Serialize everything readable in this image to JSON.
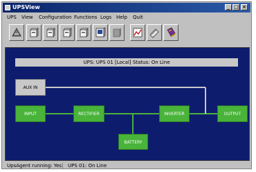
{
  "window": {
    "title": "UPSView"
  },
  "menu": [
    "UPS",
    "View",
    "Configuration",
    "Functions",
    "Logs",
    "Help",
    "Quit"
  ],
  "toolbar": [
    "ups-icon",
    "ups-unit-icon",
    "ups-unit-icon",
    "ups-unit-icon",
    "ups-unit-icon",
    "monitor-icon",
    "ups-disabled-icon",
    "chart-icon",
    "tool-icon",
    "book-icon"
  ],
  "info": "UPS: UPS 01 [Local]     Status: On Line",
  "blocks": {
    "aux": "AUX IN",
    "input": "INPUT",
    "rectifier": "RECTIFIER",
    "inverter": "INVERTER",
    "output": "OUTPUT",
    "battery": "BATTERY"
  },
  "status": {
    "left": "UpsAgent running: Yes",
    "right": "UPS 01: On Line"
  },
  "colors": {
    "diagram_bg": "#0e1c6e",
    "block_green": "#49b33a",
    "wire": "#c8c8c8"
  }
}
